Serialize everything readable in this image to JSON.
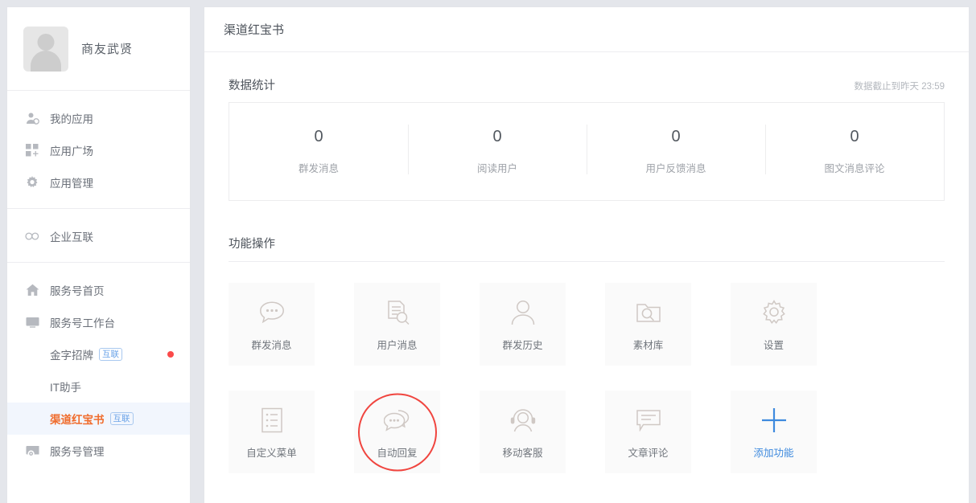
{
  "sidebar": {
    "profile": {
      "name": "商友武贤",
      "avatar_icon": "user-avatar-placeholder"
    },
    "group1": [
      {
        "label": "我的应用",
        "icon": "user-app-icon"
      },
      {
        "label": "应用广场",
        "icon": "grid-plus-icon"
      },
      {
        "label": "应用管理",
        "icon": "gear-icon"
      }
    ],
    "group2": [
      {
        "label": "企业互联",
        "icon": "infinity-icon"
      }
    ],
    "group3": [
      {
        "label": "服务号首页",
        "icon": "home-icon"
      },
      {
        "label": "服务号工作台",
        "icon": "monitor-icon"
      }
    ],
    "sub_items": [
      {
        "label": "金字招牌",
        "badge": "互联",
        "has_dot": true,
        "active": false
      },
      {
        "label": "IT助手",
        "badge": "",
        "has_dot": false,
        "active": false
      },
      {
        "label": "渠道红宝书",
        "badge": "互联",
        "has_dot": false,
        "active": true
      }
    ],
    "group4": [
      {
        "label": "服务号管理",
        "icon": "service-settings-icon"
      }
    ]
  },
  "main": {
    "title": "渠道红宝书",
    "stats_section": {
      "title": "数据统计",
      "note": "数据截止到昨天 23:59",
      "cells": [
        {
          "value": "0",
          "label": "群发消息"
        },
        {
          "value": "0",
          "label": "阅读用户"
        },
        {
          "value": "0",
          "label": "用户反馈消息"
        },
        {
          "value": "0",
          "label": "图文消息评论"
        }
      ]
    },
    "functions_section": {
      "title": "功能操作",
      "tiles": [
        {
          "label": "群发消息",
          "icon": "chat-bubble-dots-icon",
          "highlighted": false,
          "add": false
        },
        {
          "label": "用户消息",
          "icon": "document-search-icon",
          "highlighted": false,
          "add": false
        },
        {
          "label": "群发历史",
          "icon": "person-icon",
          "highlighted": false,
          "add": false
        },
        {
          "label": "素材库",
          "icon": "folder-search-icon",
          "highlighted": false,
          "add": false
        },
        {
          "label": "设置",
          "icon": "gear-icon",
          "highlighted": false,
          "add": false
        },
        {
          "label": "自定义菜单",
          "icon": "list-document-icon",
          "highlighted": false,
          "add": false
        },
        {
          "label": "自动回复",
          "icon": "double-chat-bubble-icon",
          "highlighted": true,
          "add": false
        },
        {
          "label": "移动客服",
          "icon": "headset-agent-icon",
          "highlighted": false,
          "add": false
        },
        {
          "label": "文章评论",
          "icon": "comment-box-icon",
          "highlighted": false,
          "add": false
        },
        {
          "label": "添加功能",
          "icon": "plus-icon",
          "highlighted": false,
          "add": true
        }
      ]
    }
  },
  "colors": {
    "accent_orange": "#f06c2c",
    "accent_blue": "#3e8ade",
    "badge_blue": "#6aa3e8",
    "dot_red": "#fb4a4a",
    "annotation_red": "#f0453f"
  }
}
